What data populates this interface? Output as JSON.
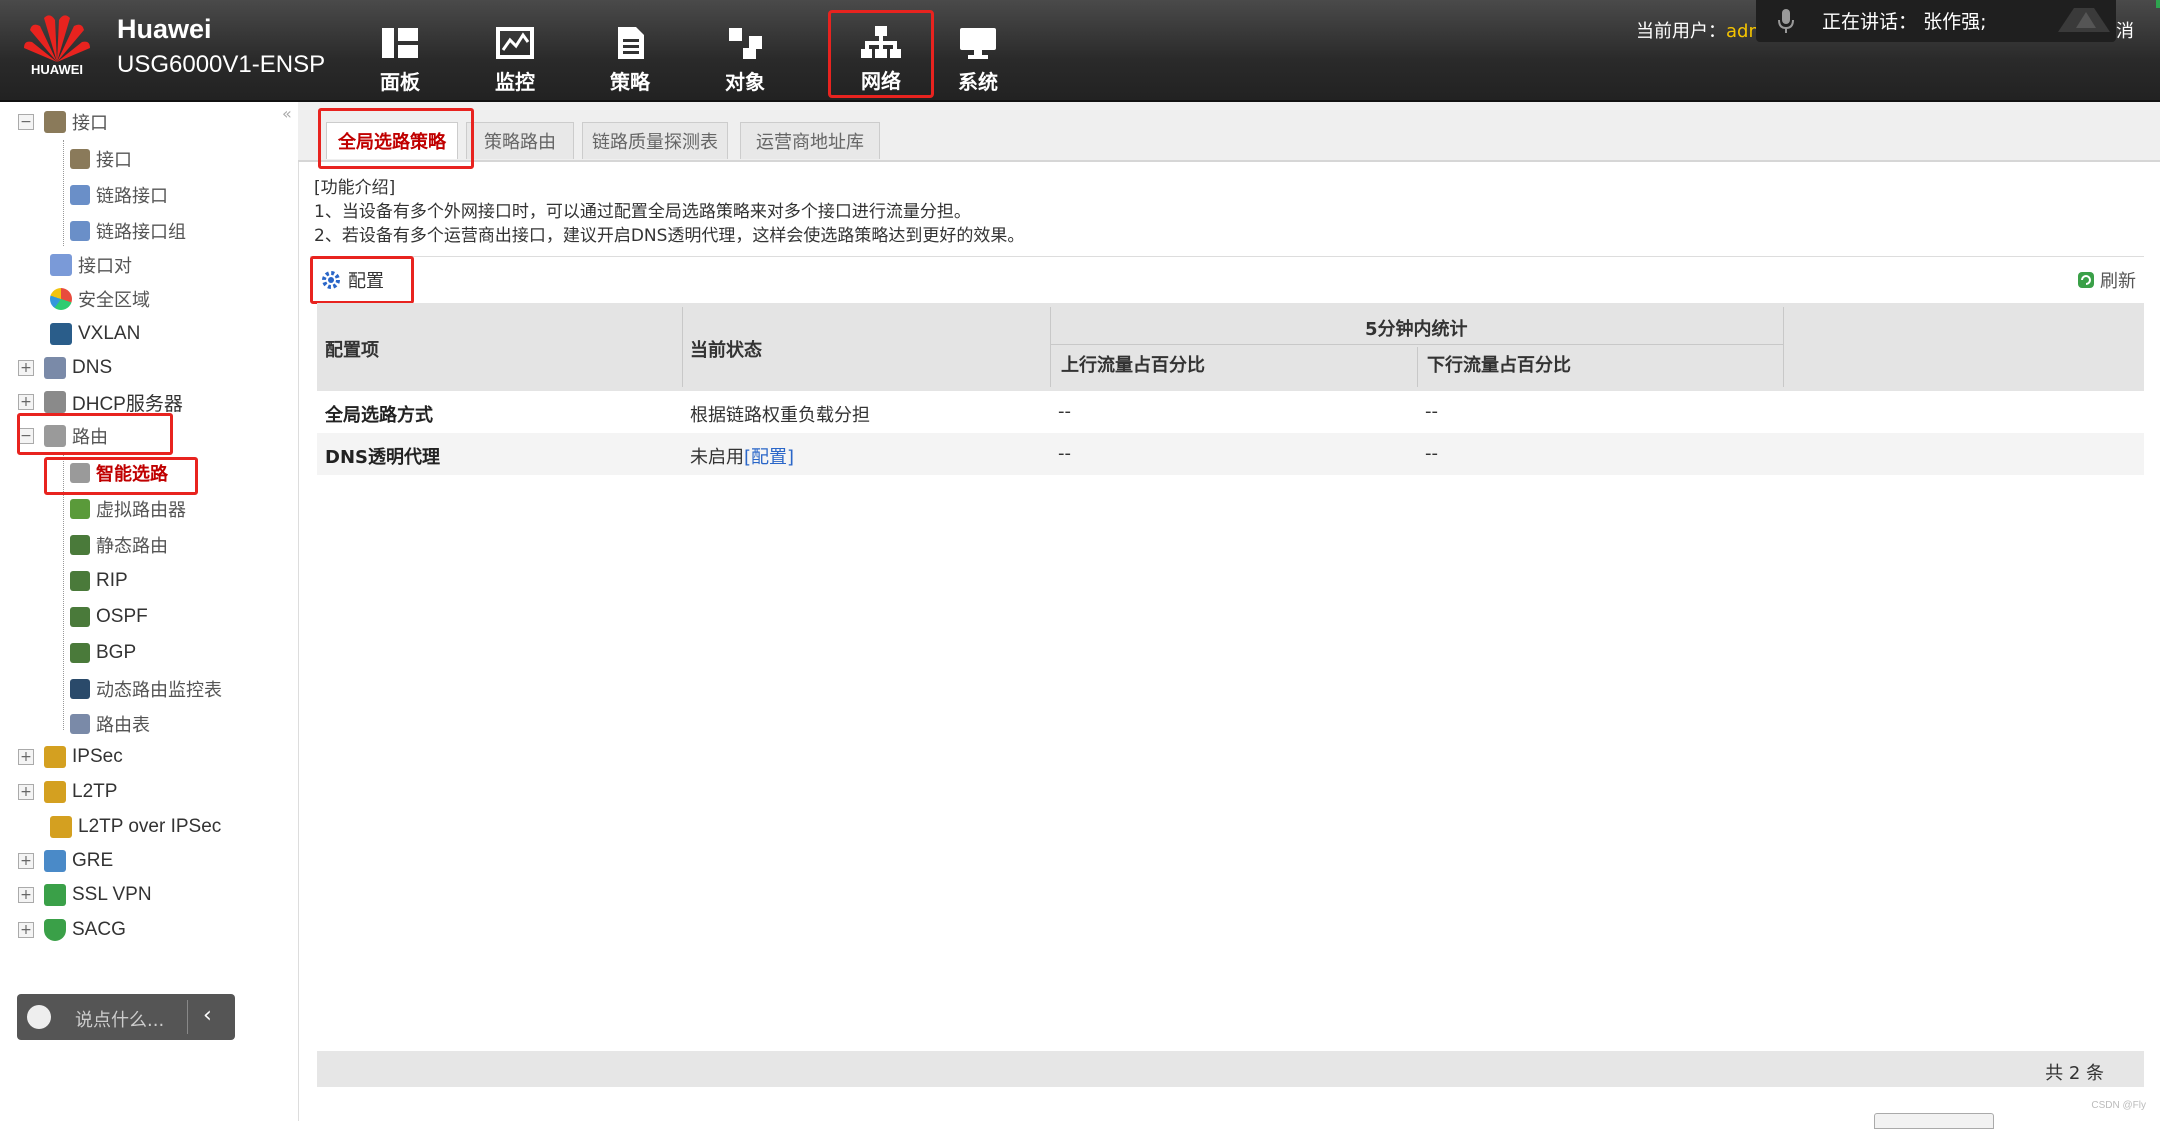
{
  "header": {
    "brand_line1": "Huawei",
    "brand_line2": "USG6000V1-ENSP",
    "logo_text": "HUAWEI",
    "nav": [
      {
        "label": "面板",
        "icon": "dashboard-icon"
      },
      {
        "label": "监控",
        "icon": "monitor-icon"
      },
      {
        "label": "策略",
        "icon": "policy-icon"
      },
      {
        "label": "对象",
        "icon": "object-icon"
      },
      {
        "label": "网络",
        "icon": "network-icon",
        "selected": true
      },
      {
        "label": "系统",
        "icon": "system-icon"
      }
    ],
    "user_prefix": "当前用户：",
    "user_name": "adm",
    "talk_label": "正在讲话：",
    "talk_name": "张作强;",
    "logout_fragment": "消"
  },
  "sidebar": {
    "items": [
      {
        "label": "接口"
      },
      {
        "label": "接口"
      },
      {
        "label": "链路接口"
      },
      {
        "label": "链路接口组"
      },
      {
        "label": "接口对"
      },
      {
        "label": "安全区域"
      },
      {
        "label": "VXLAN"
      },
      {
        "label": "DNS"
      },
      {
        "label": "DHCP服务器"
      },
      {
        "label": "路由"
      },
      {
        "label": "智能选路"
      },
      {
        "label": "虚拟路由器"
      },
      {
        "label": "静态路由"
      },
      {
        "label": "RIP"
      },
      {
        "label": "OSPF"
      },
      {
        "label": "BGP"
      },
      {
        "label": "动态路由监控表"
      },
      {
        "label": "路由表"
      },
      {
        "label": "IPSec"
      },
      {
        "label": "L2TP"
      },
      {
        "label": "L2TP over IPSec"
      },
      {
        "label": "GRE"
      },
      {
        "label": "SSL VPN"
      },
      {
        "label": "SACG"
      }
    ],
    "chat_placeholder": "说点什么..."
  },
  "tabs": [
    {
      "label": "全局选路策略",
      "active": true
    },
    {
      "label": "策略路由"
    },
    {
      "label": "链路质量探测表"
    },
    {
      "label": "运营商地址库"
    }
  ],
  "intro": {
    "title": "[功能介绍]",
    "line1": "1、当设备有多个外网接口时，可以通过配置全局选路策略来对多个接口进行流量分担。",
    "line2": "2、若设备有多个运营商出接口，建议开启DNS透明代理，这样会使选路策略达到更好的效果。"
  },
  "toolbar": {
    "config_label": "配置",
    "refresh_label": "刷新"
  },
  "table": {
    "headers": {
      "item": "配置项",
      "status": "当前状态",
      "group": "5分钟内统计",
      "up": "上行流量占百分比",
      "down": "下行流量占百分比"
    },
    "rows": [
      {
        "item": "全局选路方式",
        "status": "根据链路权重负载分担",
        "status_link": "",
        "up": "--",
        "down": "--"
      },
      {
        "item": "DNS透明代理",
        "status": "未启用",
        "status_link": "[配置]",
        "up": "--",
        "down": "--"
      }
    ],
    "total": "共 2 条"
  },
  "watermark": "CSDN @Fly",
  "colors": {
    "highlight": "#e8231f",
    "accent_red": "#c00000",
    "link": "#2a66c8",
    "user_yellow": "#f5c400"
  }
}
